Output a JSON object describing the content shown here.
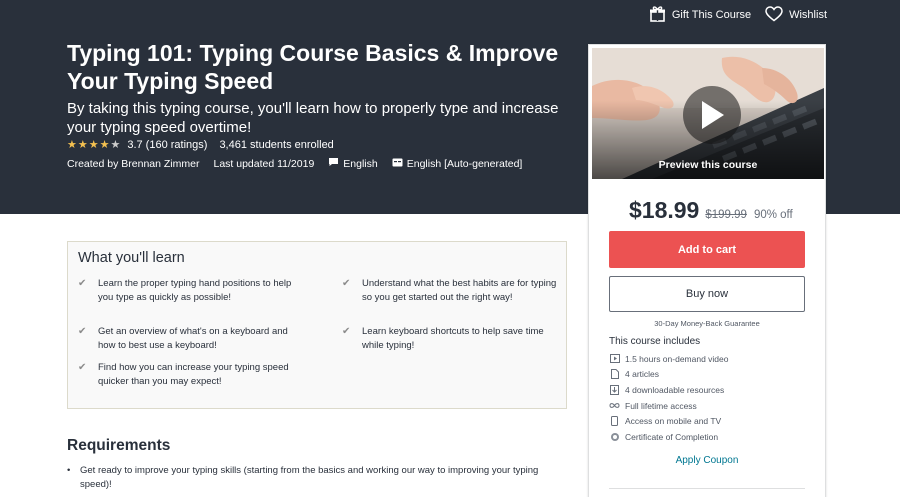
{
  "header": {
    "gift_label": "Gift This Course",
    "wishlist_label": "Wishlist"
  },
  "course": {
    "title": "Typing 101: Typing Course Basics & Improve Your Typing Speed",
    "subtitle": "By taking this typing course, you'll learn how to properly type and increase your typing speed overtime!",
    "rating_value": 4,
    "rating_text": "3.7 (160 ratings)",
    "students": "3,461 students enrolled",
    "created_by": "Created by Brennan Zimmer",
    "last_updated": "Last updated 11/2019",
    "language": "English",
    "captions": "English [Auto-generated]"
  },
  "sidebar": {
    "preview_label": "Preview this course",
    "price": "$18.99",
    "original_price": "$199.99",
    "discount": "90% off",
    "add_to_cart": "Add to cart",
    "buy_now": "Buy now",
    "guarantee": "30-Day Money-Back Guarantee",
    "includes_title": "This course includes",
    "includes": [
      {
        "icon": "video-icon",
        "label": "1.5 hours on-demand video"
      },
      {
        "icon": "file-icon",
        "label": "4 articles"
      },
      {
        "icon": "download-icon",
        "label": "4 downloadable resources"
      },
      {
        "icon": "infinity-icon",
        "label": "Full lifetime access"
      },
      {
        "icon": "mobile-icon",
        "label": "Access on mobile and TV"
      },
      {
        "icon": "certificate-icon",
        "label": "Certificate of Completion"
      }
    ],
    "apply_coupon": "Apply Coupon"
  },
  "learn": {
    "title": "What you'll learn",
    "items": [
      "Learn the proper typing hand positions to help you type as quickly as possible!",
      "Understand what the best habits are for typing so you get started out the right way!",
      "Get an overview of what's on a keyboard and how to best use a keyboard!",
      "Learn keyboard shortcuts to help save time while typing!",
      "Find how you can increase your typing speed quicker than you may expect!"
    ]
  },
  "requirements": {
    "title": "Requirements",
    "items": [
      "Get ready to improve your typing skills (starting from the basics and working our way to improving your typing speed)!"
    ]
  },
  "colors": {
    "hero_bg": "#29303b",
    "accent": "#ec5252",
    "star": "#f4c150",
    "link": "#007791"
  }
}
